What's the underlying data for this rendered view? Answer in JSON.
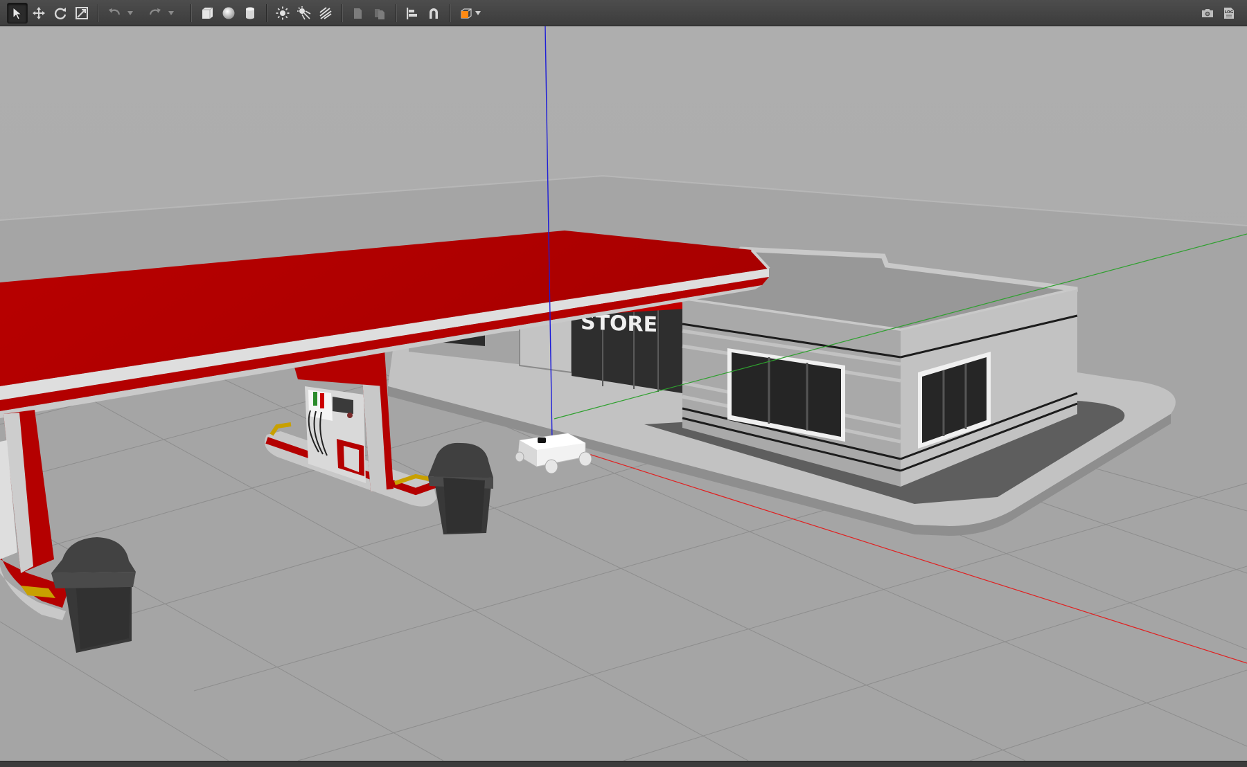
{
  "toolbar": {
    "tools": [
      {
        "id": "select",
        "icon": "arrow-cursor-icon",
        "active": true
      },
      {
        "id": "translate",
        "icon": "move-arrows-icon"
      },
      {
        "id": "rotate",
        "icon": "rotate-icon"
      },
      {
        "id": "scale",
        "icon": "scale-icon"
      }
    ],
    "history": [
      {
        "id": "undo",
        "icon": "undo-icon"
      },
      {
        "id": "redo",
        "icon": "redo-icon"
      }
    ],
    "shapes": [
      {
        "id": "box",
        "icon": "box-shape-icon"
      },
      {
        "id": "sphere",
        "icon": "sphere-shape-icon"
      },
      {
        "id": "cylinder",
        "icon": "cylinder-shape-icon"
      }
    ],
    "lights": [
      {
        "id": "point-light",
        "icon": "point-light-icon"
      },
      {
        "id": "spot-light",
        "icon": "spot-light-icon"
      },
      {
        "id": "directional-light",
        "icon": "directional-light-icon"
      }
    ],
    "edit": [
      {
        "id": "copy",
        "icon": "copy-icon"
      },
      {
        "id": "paste",
        "icon": "paste-icon"
      }
    ],
    "align": [
      {
        "id": "align",
        "icon": "align-icon"
      },
      {
        "id": "snap",
        "icon": "magnet-icon"
      }
    ],
    "view": {
      "id": "view-angle",
      "icon": "view-cube-icon"
    },
    "right": [
      {
        "id": "screenshot",
        "icon": "camera-icon"
      },
      {
        "id": "log",
        "icon": "log-icon",
        "label": "LOG"
      }
    ]
  },
  "scene": {
    "store_sign": "STORE",
    "colors": {
      "sky": "#acacac",
      "ground": "#a6a6a6",
      "grid": "#8c8c8c",
      "canopy_red": "#b00000",
      "building_gray": "#9a9a9a",
      "axis_x": "#e02020",
      "axis_y": "#2ea02e",
      "axis_z": "#1c1cd8",
      "bin": "#3b3b3b"
    }
  }
}
